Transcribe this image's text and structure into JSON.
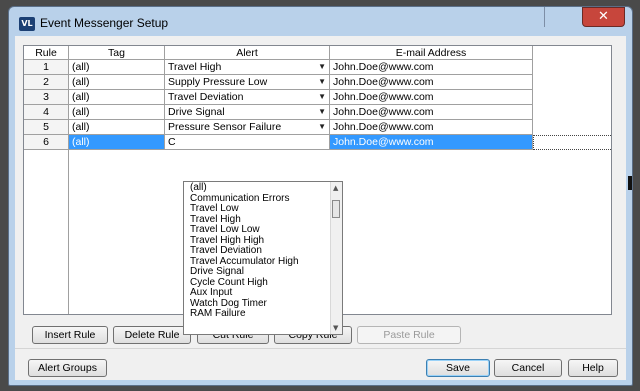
{
  "window": {
    "title": "Event Messenger Setup",
    "app_icon_text": "VL",
    "close_glyph": "✕"
  },
  "grid": {
    "headers": {
      "rule": "Rule",
      "tag": "Tag",
      "alert": "Alert",
      "email": "E-mail Address"
    },
    "rows": [
      {
        "rule": "1",
        "tag": "(all)",
        "alert": "Travel High",
        "email": "John.Doe@www.com"
      },
      {
        "rule": "2",
        "tag": "(all)",
        "alert": "Supply Pressure Low",
        "email": "John.Doe@www.com"
      },
      {
        "rule": "3",
        "tag": "(all)",
        "alert": "Travel Deviation",
        "email": "John.Doe@www.com"
      },
      {
        "rule": "4",
        "tag": "(all)",
        "alert": "Drive Signal",
        "email": "John.Doe@www.com"
      },
      {
        "rule": "5",
        "tag": "(all)",
        "alert": "Pressure Sensor Failure",
        "email": "John.Doe@www.com"
      },
      {
        "rule": "6",
        "tag": "(all)",
        "alert": "C",
        "email": "John.Doe@www.com"
      }
    ],
    "dropdown_arrow": "▼"
  },
  "dropdown": {
    "items": [
      "(all)",
      "Communication Errors",
      "Travel Low",
      "Travel High",
      "Travel Low Low",
      "Travel High High",
      "Travel Deviation",
      "Travel Accumulator High",
      "Drive Signal",
      "Cycle Count High",
      "Aux Input",
      "Watch Dog Timer",
      "RAM Failure"
    ],
    "scroll_up": "▲",
    "scroll_down": "▼"
  },
  "buttons": {
    "insert_rule": "Insert Rule",
    "delete_rule": "Delete Rule",
    "cut_rule": "Cut Rule",
    "copy_rule": "Copy Rule",
    "paste_rule": "Paste Rule",
    "alert_groups": "Alert Groups",
    "save": "Save",
    "cancel": "Cancel",
    "help": "Help"
  }
}
